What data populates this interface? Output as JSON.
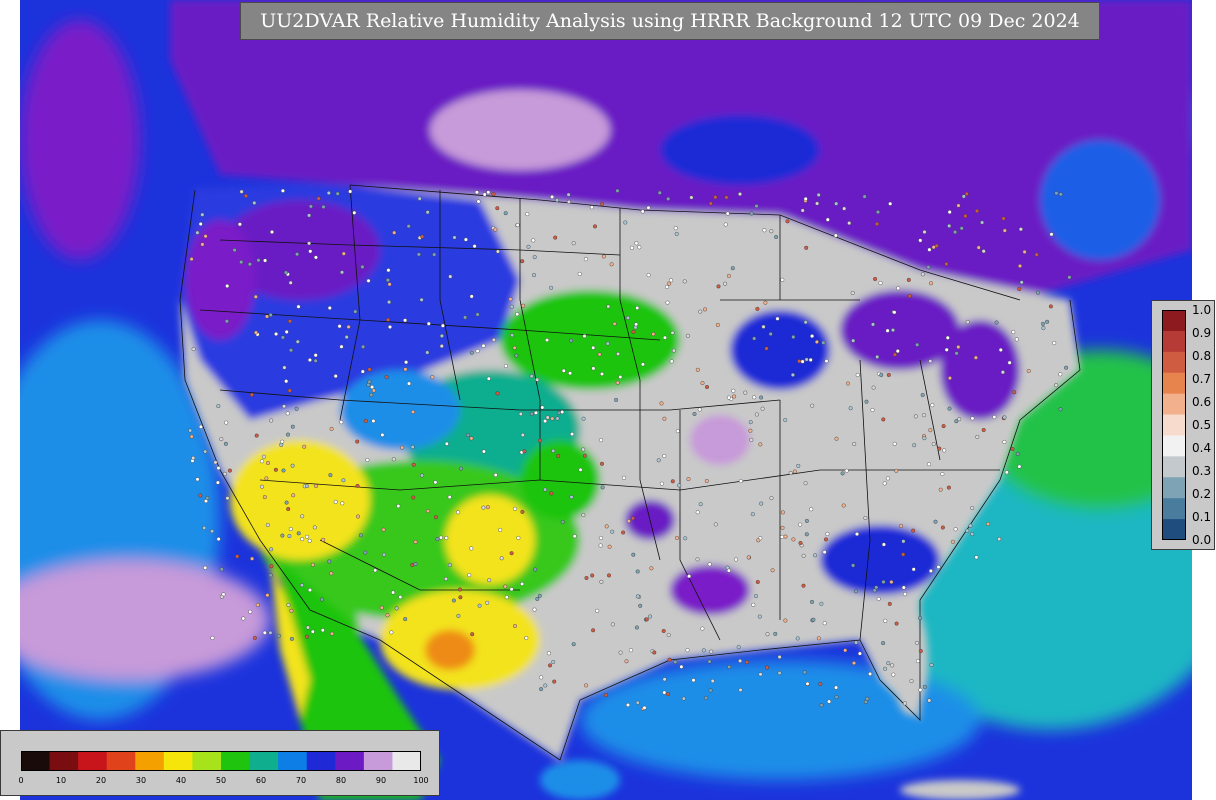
{
  "title": "UU2DVAR Relative Humidity Analysis using HRRR Background 12 UTC 09 Dec 2024",
  "rh_colorbar": {
    "ticks": [
      "0",
      "10",
      "20",
      "30",
      "40",
      "50",
      "60",
      "70",
      "80",
      "90",
      "100"
    ],
    "colors": [
      "#1a0b0b",
      "#7a0d10",
      "#c8151c",
      "#e0421c",
      "#f4a000",
      "#f5e50a",
      "#a7e21a",
      "#1ec40e",
      "#0fae8f",
      "#0c7ee6",
      "#1f2ad6",
      "#6b1ac4",
      "#c79ad9",
      "#e9e9e9"
    ]
  },
  "value_colorbar": {
    "ticks": [
      "1.0",
      "0.9",
      "0.8",
      "0.7",
      "0.6",
      "0.5",
      "0.4",
      "0.3",
      "0.2",
      "0.1",
      "0.0"
    ],
    "colors": [
      "#8c1a1f",
      "#b63a35",
      "#cf5b40",
      "#e7834d",
      "#f2b08d",
      "#f7dccd",
      "#f2f2f2",
      "#c3c9cc",
      "#7da3b4",
      "#4a7c9e",
      "#1f4e7e"
    ]
  },
  "map_colors": {
    "ocean_deep": "#1c33dc",
    "ocean_mid": "#1e8ee8",
    "ocean_teal": "#1fb7c3",
    "moist_purple": "#6b1ac4",
    "saturated": "#c6c6c6",
    "dry_green": "#39c81a",
    "dry_yellow": "#f3e31a",
    "very_dry": "#ee8a12",
    "boundary": "#111111"
  }
}
